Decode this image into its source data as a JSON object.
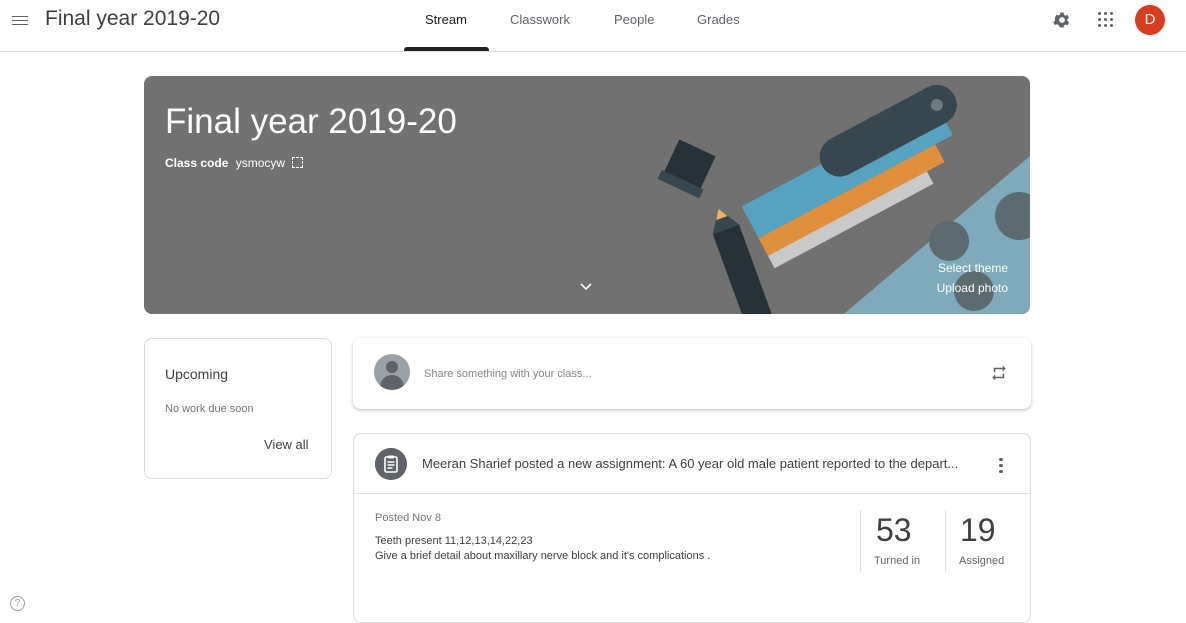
{
  "header": {
    "title": "Final year 2019-20",
    "tabs": [
      "Stream",
      "Classwork",
      "People",
      "Grades"
    ],
    "active_tab": "Stream",
    "avatar_letter": "D"
  },
  "banner": {
    "title": "Final year 2019-20",
    "class_code_label": "Class code",
    "class_code": "ysmocyw",
    "select_theme": "Select theme",
    "upload_photo": "Upload photo"
  },
  "upcoming": {
    "title": "Upcoming",
    "empty": "No work due soon",
    "view_all": "View all"
  },
  "share": {
    "placeholder": "Share something with your class..."
  },
  "post": {
    "title": "Meeran Sharief posted a new assignment: A 60 year old male patient reported to the depart...",
    "posted": "Posted Nov 8",
    "line1": "Teeth present 11,12,13,14,22,23",
    "line2": "Give a brief detail about maxillary nerve block and it's complications .",
    "turned_in_count": "53",
    "turned_in_label": "Turned in",
    "assigned_count": "19",
    "assigned_label": "Assigned"
  },
  "help": "?"
}
